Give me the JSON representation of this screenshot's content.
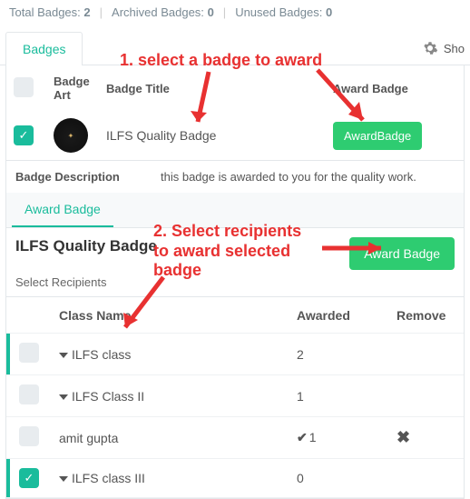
{
  "stats": {
    "total_label": "Total Badges:",
    "total_value": "2",
    "archived_label": "Archived Badges:",
    "archived_value": "0",
    "unused_label": "Unused Badges:",
    "unused_value": "0"
  },
  "tab_badges": "Badges",
  "show_label": "Sho",
  "headers": {
    "art": "Badge Art",
    "title": "Badge Title",
    "award": "Award Badge"
  },
  "row": {
    "title": "ILFS Quality Badge",
    "award_btn": "AwardBadge"
  },
  "desc": {
    "label": "Badge Description",
    "text": "this badge is awarded to you for the quality work."
  },
  "subtab": "Award Badge",
  "award": {
    "title": "ILFS Quality Badge",
    "btn": "Award Badge",
    "select": "Select Recipients"
  },
  "rhead": {
    "class": "Class Name",
    "awarded": "Awarded",
    "remove": "Remove"
  },
  "rows": [
    {
      "name": "ILFS class",
      "awarded": "2",
      "caret": true,
      "checked": false,
      "flag": true,
      "tick": false,
      "remove": false
    },
    {
      "name": "ILFS Class II",
      "awarded": "1",
      "caret": true,
      "checked": false,
      "flag": false,
      "tick": false,
      "remove": false
    },
    {
      "name": "amit gupta",
      "awarded": "1",
      "caret": false,
      "checked": false,
      "flag": false,
      "tick": true,
      "remove": true
    },
    {
      "name": "ILFS class III",
      "awarded": "0",
      "caret": true,
      "checked": true,
      "flag": true,
      "tick": false,
      "remove": false
    }
  ],
  "anno1": "1.   select a badge to award",
  "anno2_l1": "2. Select recipients",
  "anno2_l2": "to award selected",
  "anno2_l3": "badge"
}
